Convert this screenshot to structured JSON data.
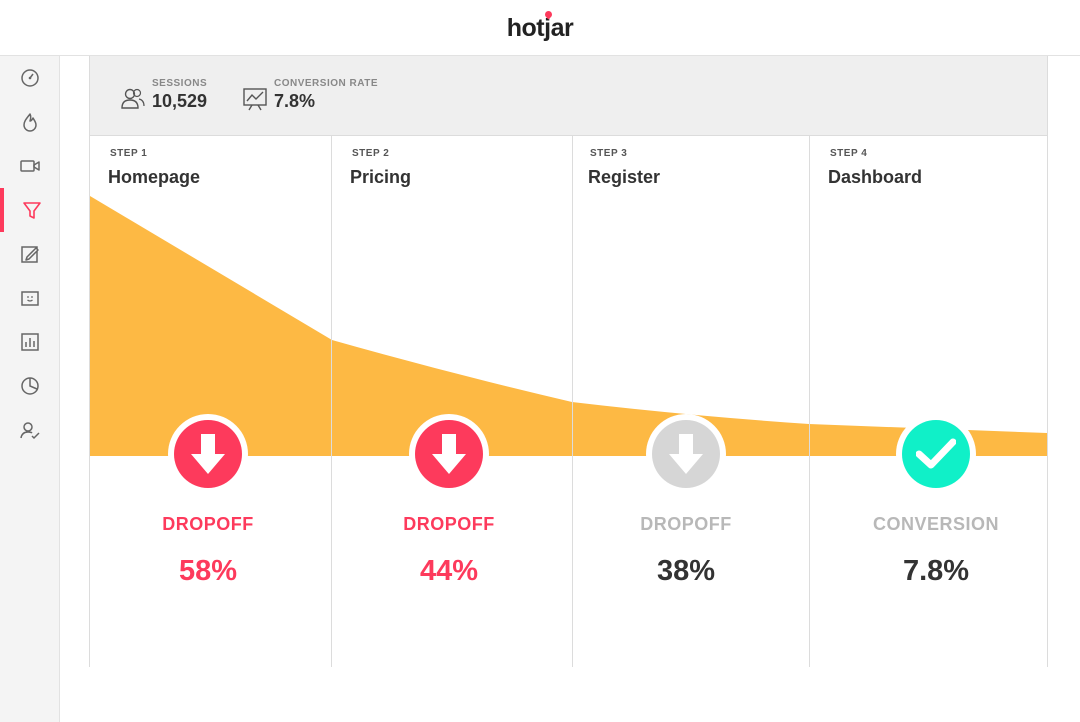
{
  "app": {
    "logo_text": "hotjar"
  },
  "sidebar": {
    "items": [
      {
        "name": "dashboard-icon",
        "active": false
      },
      {
        "name": "heatmap-icon",
        "active": false
      },
      {
        "name": "recordings-icon",
        "active": false
      },
      {
        "name": "funnel-icon",
        "active": true
      },
      {
        "name": "forms-icon",
        "active": false
      },
      {
        "name": "feedback-icon",
        "active": false
      },
      {
        "name": "polls-icon",
        "active": false
      },
      {
        "name": "surveys-icon",
        "active": false
      },
      {
        "name": "recruiters-icon",
        "active": false
      }
    ]
  },
  "stats": {
    "sessions_label": "SESSIONS",
    "sessions_value": "10,529",
    "conversion_label": "CONVERSION RATE",
    "conversion_value": "7.8%"
  },
  "steps": [
    {
      "num": "STEP 1",
      "name": "Homepage",
      "metric_label": "DROPOFF",
      "metric_value": "58%",
      "state": "dropoff-active"
    },
    {
      "num": "STEP 2",
      "name": "Pricing",
      "metric_label": "DROPOFF",
      "metric_value": "44%",
      "state": "dropoff-active"
    },
    {
      "num": "STEP 3",
      "name": "Register",
      "metric_label": "DROPOFF",
      "metric_value": "38%",
      "state": "dropoff-inactive"
    },
    {
      "num": "STEP 4",
      "name": "Dashboard",
      "metric_label": "CONVERSION",
      "metric_value": "7.8%",
      "state": "conversion"
    }
  ],
  "colors": {
    "accent": "#fd3a5c",
    "funnel_fill": "#fdb944",
    "conversion": "#10f0c8",
    "inactive": "#d6d6d6",
    "inactive_text": "#b8b8b8"
  }
}
